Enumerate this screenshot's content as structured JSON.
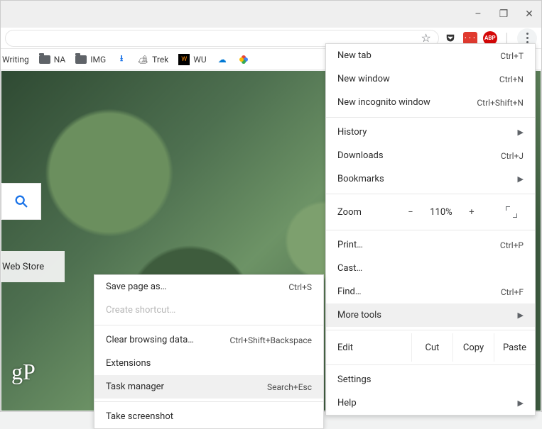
{
  "window": {
    "minimize": "–",
    "maximize": "❐",
    "close": "✕"
  },
  "extensions": {
    "pocket": "pocket",
    "red_label": "• • •",
    "abp_label": "ABP"
  },
  "bookmarks": {
    "writing": "Writing",
    "na": "NA",
    "img": "IMG",
    "trek": "Trek",
    "wu": "WU"
  },
  "page": {
    "webstore": "Web Store",
    "logo": "gP"
  },
  "menu": {
    "new_tab": "New tab",
    "new_tab_sc": "Ctrl+T",
    "new_window": "New window",
    "new_window_sc": "Ctrl+N",
    "incognito": "New incognito window",
    "incognito_sc": "Ctrl+Shift+N",
    "history": "History",
    "downloads": "Downloads",
    "downloads_sc": "Ctrl+J",
    "bookmarks": "Bookmarks",
    "zoom_label": "Zoom",
    "zoom_minus": "−",
    "zoom_pct": "110%",
    "zoom_plus": "+",
    "print": "Print…",
    "print_sc": "Ctrl+P",
    "cast": "Cast…",
    "find": "Find…",
    "find_sc": "Ctrl+F",
    "more_tools": "More tools",
    "edit": "Edit",
    "cut": "Cut",
    "copy": "Copy",
    "paste": "Paste",
    "settings": "Settings",
    "help": "Help"
  },
  "submenu": {
    "save_page": "Save page as…",
    "save_page_sc": "Ctrl+S",
    "create_shortcut": "Create shortcut…",
    "clear_browsing": "Clear browsing data…",
    "clear_browsing_sc": "Ctrl+Shift+Backspace",
    "extensions": "Extensions",
    "task_manager": "Task manager",
    "task_manager_sc": "Search+Esc",
    "take_screenshot": "Take screenshot"
  }
}
